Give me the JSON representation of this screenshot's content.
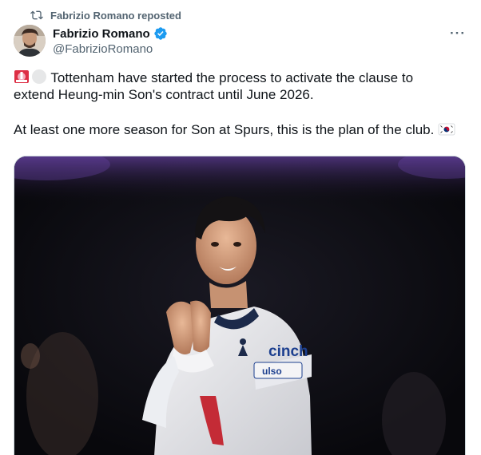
{
  "repost": {
    "label": "Fabrizio Romano reposted",
    "icon": "repost-icon"
  },
  "author": {
    "display_name": "Fabrizio Romano",
    "handle": "@FabrizioRomano",
    "verified": true,
    "verified_color": "#1d9bf0"
  },
  "more_icon": "more-horizontal-icon",
  "more_label": "···",
  "tweet": {
    "line1": "Tottenham have started the process to activate the clause to",
    "line2": "extend Heung-min Son's contract until June 2026.",
    "line3": "At least one more season for Son at Spurs, this is the plan of the club.",
    "emojis": [
      "siren-emoji",
      "white-circle-emoji",
      "south-korea-flag-emoji"
    ]
  },
  "media": {
    "kind": "photo",
    "kit_sponsor": "cinch",
    "armband_text": "ulso"
  },
  "colors": {
    "text_primary": "#0f1419",
    "text_secondary": "#536471",
    "border": "#cfd9de"
  }
}
